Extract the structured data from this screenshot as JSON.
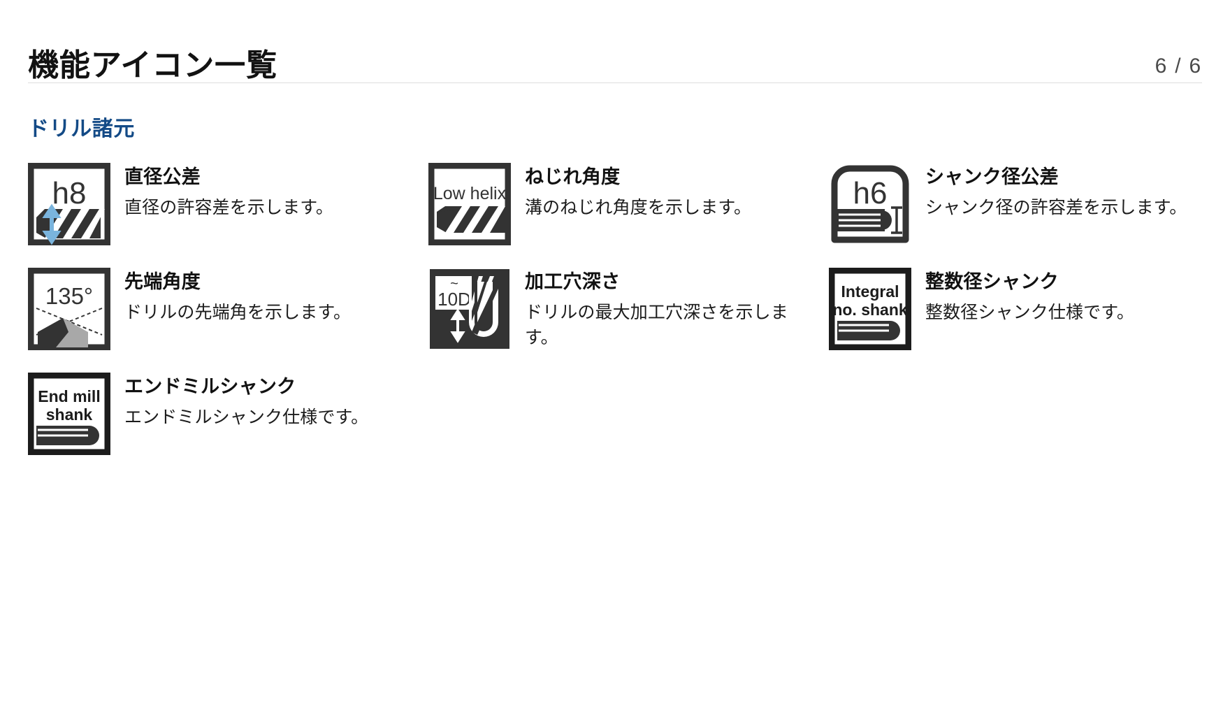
{
  "header": {
    "title": "機能アイコン一覧",
    "page_counter": "6 / 6"
  },
  "section": {
    "heading": "ドリル諸元",
    "heading_color": "#134a86"
  },
  "items": [
    {
      "icon": "h8-diameter-tolerance-icon",
      "icon_label": "h8",
      "name": "直径公差",
      "desc": "直径の許容差を示します。"
    },
    {
      "icon": "low-helix-icon",
      "icon_label": "Low helix",
      "name": "ねじれ角度",
      "desc": "溝のねじれ角度を示します。"
    },
    {
      "icon": "h6-shank-tolerance-icon",
      "icon_label": "h6",
      "name": "シャンク径公差",
      "desc": "シャンク径の許容差を示します。"
    },
    {
      "icon": "point-angle-135-icon",
      "icon_label": "135°",
      "name": "先端角度",
      "desc": "ドリルの先端角を示します。"
    },
    {
      "icon": "hole-depth-10d-icon",
      "icon_label": "~10D",
      "name": "加工穴深さ",
      "desc": "ドリルの最大加工穴深さを示します。"
    },
    {
      "icon": "integral-no-shank-icon",
      "icon_label_line1": "Integral",
      "icon_label_line2": "no. shank",
      "name": "整数径シャンク",
      "desc": "整数径シャンク仕様です。"
    },
    {
      "icon": "end-mill-shank-icon",
      "icon_label_line1": "End mill",
      "icon_label_line2": "shank",
      "name": "エンドミルシャンク",
      "desc": "エンドミルシャンク仕様です。"
    }
  ],
  "colors": {
    "accent_blue": "#134a86",
    "arrow_blue": "#7ab4dd",
    "icon_dark": "#333333",
    "text": "#111111"
  }
}
